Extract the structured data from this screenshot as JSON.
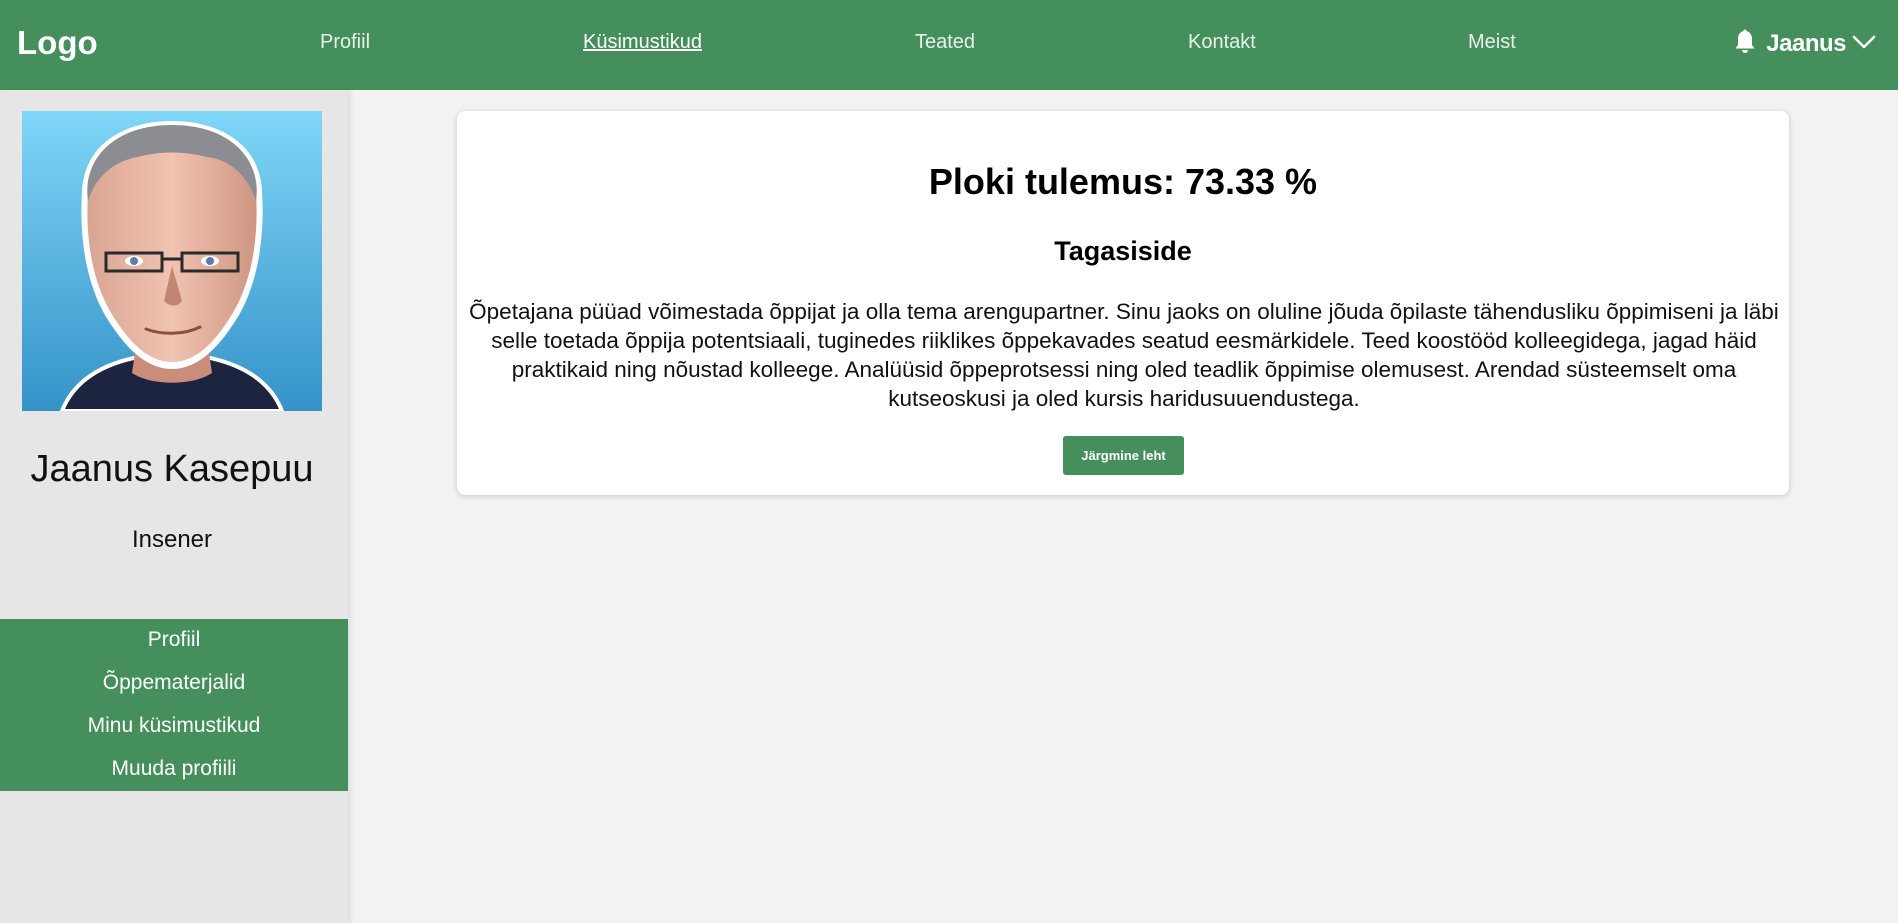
{
  "header": {
    "logo": "Logo",
    "nav": [
      {
        "label": "Profiil",
        "active": false
      },
      {
        "label": "Küsimustikud",
        "active": true
      },
      {
        "label": "Teated",
        "active": false
      },
      {
        "label": "Kontakt",
        "active": false
      },
      {
        "label": "Meist",
        "active": false
      }
    ],
    "user_name": "Jaanus"
  },
  "sidebar": {
    "name": "Jaanus Kasepuu",
    "role": "Insener",
    "menu": [
      {
        "label": "Profiil"
      },
      {
        "label": "Õppematerjalid"
      },
      {
        "label": "Minu küsimustikud"
      },
      {
        "label": "Muuda profiili"
      }
    ]
  },
  "main": {
    "result_title": "Ploki tulemus: 73.33 %",
    "feedback_title": "Tagasiside",
    "feedback_text": "Õpetajana püüad võimestada õppijat ja olla tema arengupartner. Sinu jaoks on oluline jõuda õpilaste tähendusliku õppimiseni ja läbi selle toetada õppija potentsiaali, tuginedes riiklikes õppekavades seatud eesmärkidele. Teed koostööd kolleegidega, jagad häid praktikaid ning nõustad kolleege. Analüüsid õppeprotsessi ning oled teadlik õppimise olemusest. Arendad süsteemselt oma kutseoskusi ja oled kursis haridusuuendustega.",
    "next_button": "Järgmine leht"
  },
  "icons": {
    "notification": "bell-icon",
    "dropdown": "chevron-down-icon"
  },
  "colors": {
    "brand_green": "#448f5b",
    "sidebar_bg": "#e6e6e6",
    "page_bg": "#f2f2f2"
  }
}
